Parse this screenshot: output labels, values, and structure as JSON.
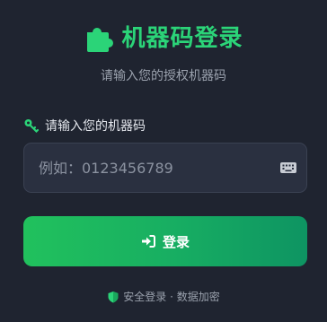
{
  "header": {
    "logo_icon": "puzzle-icon",
    "title": "机器码登录",
    "subtitle": "请输入您的授权机器码"
  },
  "form": {
    "label": "请输入您的机器码",
    "label_icon": "key-icon",
    "input": {
      "value": "",
      "placeholder": "例如：0123456789",
      "trailing_icon": "keyboard-icon"
    }
  },
  "login_button": {
    "label": "登录",
    "icon": "sign-in-icon"
  },
  "footer": {
    "icon": "shield-icon",
    "text": "安全登录 · 数据加密"
  },
  "colors": {
    "background": "#1f2430",
    "accent": "#2bd478",
    "button_start": "#21c15d",
    "button_end": "#0e9462",
    "input_bg": "#2a3040"
  }
}
